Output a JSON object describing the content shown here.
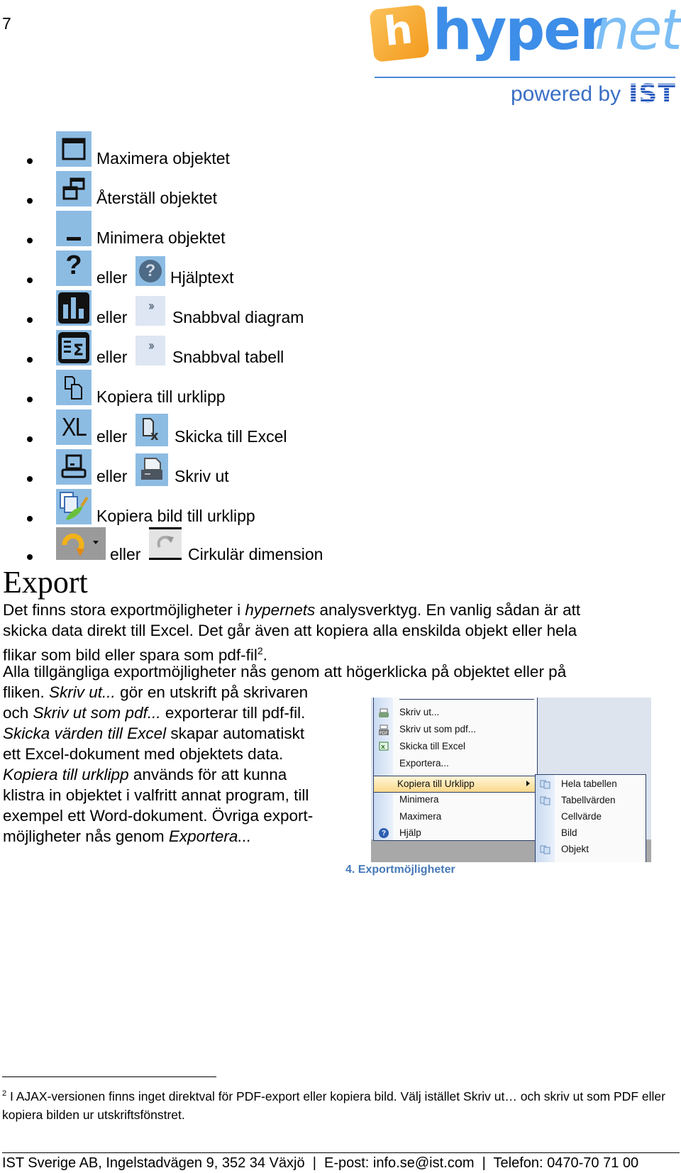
{
  "page_number": "7",
  "logo": {
    "word_part1": "hyper",
    "word_part2": "net",
    "badge_letter": "h",
    "powered_by": "powered by",
    "brand": "IST"
  },
  "list": [
    {
      "icon": "maximize-icon",
      "text": "Maximera objektet"
    },
    {
      "icon": "restore-icon",
      "text": "Återställ objektet"
    },
    {
      "icon": "minimize-icon",
      "text": "Minimera objektet"
    },
    {
      "icon": "help-icon",
      "alt_icon": "help-round-icon",
      "or": "eller",
      "text": "Hjälptext"
    },
    {
      "icon": "chart-icon",
      "alt_icon": "double-chevron-icon",
      "or": "eller",
      "text": "Snabbval diagram"
    },
    {
      "icon": "table-sigma-icon",
      "alt_icon": "double-chevron-icon",
      "or": "eller",
      "text": "Snabbval tabell"
    },
    {
      "icon": "copy-icon",
      "text": "Kopiera till urklipp"
    },
    {
      "icon": "excel-xl-icon",
      "alt_icon": "excel-send-icon",
      "or": "eller",
      "text": "Skicka till Excel"
    },
    {
      "icon": "print-icon",
      "alt_icon": "printer-icon",
      "or": "eller",
      "text": "Skriv ut"
    },
    {
      "icon": "copy-image-icon",
      "text": "Kopiera bild till urklipp"
    },
    {
      "icon": "rotate-dropdown-icon",
      "alt_icon": "rotate-icon",
      "or": "eller",
      "text": "Cirkulär dimension"
    }
  ],
  "heading": "Export",
  "body": {
    "p1_l1_a": "Det finns stora exportmöjligheter i ",
    "p1_l1_em": "hypernets",
    "p1_l1_b": " analysverktyg. En vanlig sådan är att",
    "p1_l2": "skicka data direkt till Excel. Det går även att kopiera alla enskilda objekt eller hela",
    "p1_l3": "flikar som bild eller spara som pdf-fil",
    "p1_l3_sup": "2",
    "p1_l3_end": ".",
    "p2_l1": "Alla tillgängliga exportmöjligheter nås genom att högerklicka på objektet eller på",
    "p2_l2_a": "fliken. ",
    "p2_l2_em": "Skriv ut...",
    "p2_l2_b": " gör en utskrift på skrivaren",
    "p2_l3_a": "och ",
    "p2_l3_em": "Skriv ut som pdf...",
    "p2_l3_b": " exporterar till pdf-fil.",
    "p2_l4_em": "Skicka värden till Excel",
    "p2_l4_b": " skapar automatiskt",
    "p2_l5": "ett Excel-dokument med objektets data.",
    "p2_l6_em": "Kopiera till urklipp",
    "p2_l6_b": " används för att kunna",
    "p2_l7": "klistra in objektet i valfritt annat program, till",
    "p2_l8": "exempel ett Word-dokument. Övriga export-",
    "p2_l9_a": "möjligheter nås genom ",
    "p2_l9_em": "Exportera..."
  },
  "context_menu": {
    "items": [
      "Skriv ut...",
      "Skriv ut som pdf...",
      "Skicka till Excel",
      "Exportera...",
      "Kopiera till Urklipp",
      "Minimera",
      "Maximera",
      "Hjälp"
    ],
    "highlighted": "Kopiera till Urklipp",
    "submenu": [
      "Hela tabellen",
      "Tabellvärden",
      "Cellvärde",
      "Bild",
      "Objekt"
    ]
  },
  "caption": "4. Exportmöjligheter",
  "footnote": {
    "mark": "2",
    "text": " I AJAX-versionen finns inget direktval för PDF-export eller kopiera bild. Välj istället Skriv ut… och skriv ut som PDF eller kopiera bilden ur utskriftsfönstret."
  },
  "footer": "IST Sverige AB, Ingelstadvägen 9, 352 34 Växjö  |  E-post: info.se@ist.com  |  Telefon: 0470-70 71 00"
}
